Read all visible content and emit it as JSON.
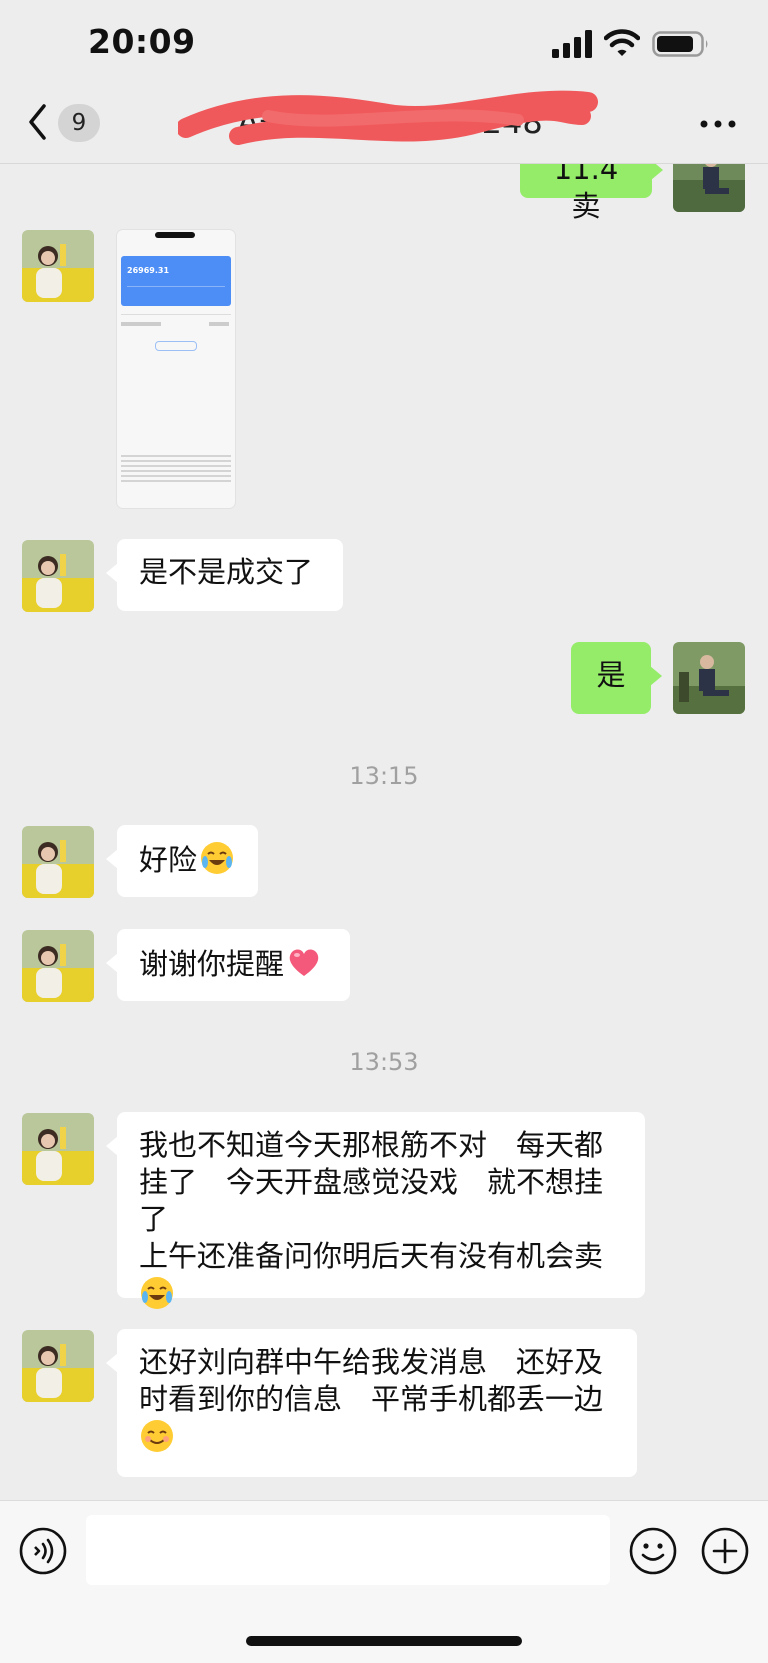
{
  "status_bar": {
    "time": "20:09"
  },
  "nav": {
    "unread_count": "9",
    "title": "A开心………… 0248",
    "icons": {
      "back": "chevron-left-icon",
      "more": "more-dots-icon"
    }
  },
  "messages": [
    {
      "side": "out",
      "text": "11.4 卖"
    },
    {
      "side": "in",
      "type": "image",
      "text": "26969.31"
    },
    {
      "side": "in",
      "text": "是不是成交了"
    },
    {
      "side": "out",
      "text": "是"
    },
    {
      "type": "time",
      "text": "13:15"
    },
    {
      "side": "in",
      "text": "好险",
      "emoji": "crying-laughing-emoji"
    },
    {
      "side": "in",
      "text": "谢谢你提醒",
      "emoji": "heart-emoji"
    },
    {
      "type": "time",
      "text": "13:53"
    },
    {
      "side": "in",
      "lines": [
        "我也不知道今天那根筋不对　每天都",
        "挂了　今天开盘感觉没戏　就不想挂了",
        "上午还准备问你明后天有没有机会卖"
      ],
      "emoji": "crying-laughing-emoji"
    },
    {
      "side": "in",
      "lines": [
        "还好刘向群中午给我发消息　还好及",
        "时看到你的信息　平常手机都丢一边"
      ],
      "emoji": "smiling-face-emoji"
    }
  ],
  "input_bar": {
    "text": "",
    "icons": {
      "voice": "voice-icon",
      "emoji": "emoji-icon",
      "plus": "plus-icon"
    }
  },
  "colors": {
    "background": "#ededed",
    "outgoing_bubble": "#95ec69",
    "incoming_bubble": "#ffffff",
    "timestamp": "#a0a0a0"
  }
}
